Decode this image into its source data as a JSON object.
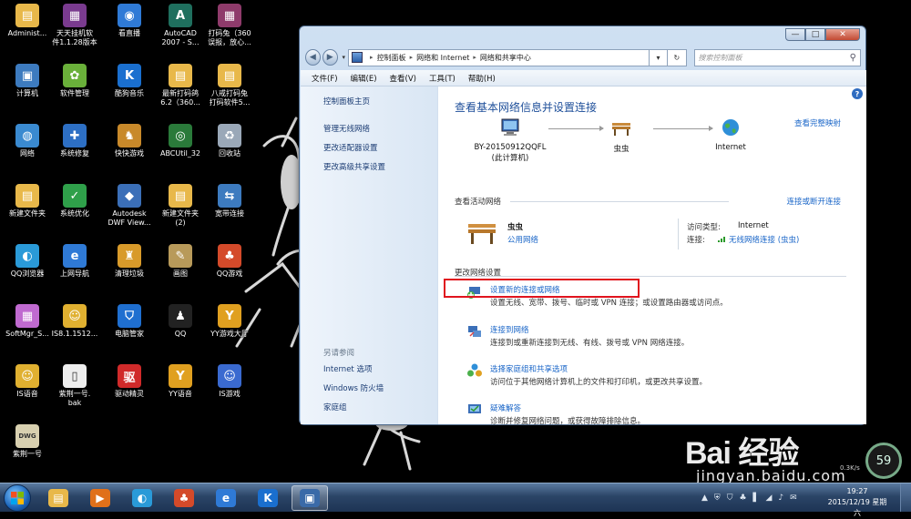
{
  "desktop": {
    "icons": [
      {
        "label": "Administ...",
        "color": "#e8b84a",
        "glyph": "▤",
        "icon": "folder-user-icon"
      },
      {
        "label": "天天挂机软\n件1.1.28版本",
        "color": "#7a3b8f",
        "glyph": "▦",
        "icon": "winrar-icon"
      },
      {
        "label": "看直播",
        "color": "#2f7ad6",
        "glyph": "◉",
        "icon": "live-icon"
      },
      {
        "label": "AutoCAD\n2007 - S...",
        "color": "#1f6f5e",
        "glyph": "A",
        "icon": "autocad-icon"
      },
      {
        "label": "打码兔（360\n误报，放心...",
        "color": "#8f3b6b",
        "glyph": "▦",
        "icon": "winrar-icon"
      },
      {
        "label": "计算机",
        "color": "#3d7bbf",
        "glyph": "▣",
        "icon": "computer-icon"
      },
      {
        "label": "软件管理",
        "color": "#6ab03a",
        "glyph": "✿",
        "icon": "software-manager-icon"
      },
      {
        "label": "酷狗音乐",
        "color": "#1a6fcf",
        "glyph": "K",
        "icon": "kugou-icon"
      },
      {
        "label": "最新打码鸽\n6.2（360...",
        "color": "#e8b84a",
        "glyph": "▤",
        "icon": "folder-icon"
      },
      {
        "label": "八戒打码兔\n打码软件5...",
        "color": "#e8b84a",
        "glyph": "▤",
        "icon": "folder-icon"
      },
      {
        "label": "网络",
        "color": "#3a8ad0",
        "glyph": "◍",
        "icon": "network-icon"
      },
      {
        "label": "系统修复",
        "color": "#2d6fc4",
        "glyph": "✚",
        "icon": "system-repair-icon"
      },
      {
        "label": "快快游戏",
        "color": "#c8892a",
        "glyph": "♞",
        "icon": "game-icon"
      },
      {
        "label": "ABCUtil_32",
        "color": "#2a7a3a",
        "glyph": "◎",
        "icon": "abc-icon"
      },
      {
        "label": "回收站",
        "color": "#9aa8b8",
        "glyph": "♻",
        "icon": "recycle-bin-icon"
      },
      {
        "label": "新建文件夹",
        "color": "#e8b84a",
        "glyph": "▤",
        "icon": "folder-icon"
      },
      {
        "label": "系统优化",
        "color": "#2fa04a",
        "glyph": "✓",
        "icon": "optimize-icon"
      },
      {
        "label": "Autodesk\nDWF View...",
        "color": "#3b6fb8",
        "glyph": "◆",
        "icon": "autodesk-icon"
      },
      {
        "label": "新建文件夹\n(2)",
        "color": "#e8b84a",
        "glyph": "▤",
        "icon": "folder-icon"
      },
      {
        "label": "宽带连接",
        "color": "#3d7bbf",
        "glyph": "⇆",
        "icon": "broadband-icon"
      },
      {
        "label": "QQ浏览器",
        "color": "#2a9ad8",
        "glyph": "◐",
        "icon": "qq-browser-icon"
      },
      {
        "label": "上网导航",
        "color": "#2f7ad6",
        "glyph": "e",
        "icon": "ie-icon"
      },
      {
        "label": "清理垃圾",
        "color": "#d89a2a",
        "glyph": "♜",
        "icon": "cleanup-icon"
      },
      {
        "label": "画图",
        "color": "#b89a5a",
        "glyph": "✎",
        "icon": "paint-icon"
      },
      {
        "label": "QQ游戏",
        "color": "#d44a2a",
        "glyph": "♣",
        "icon": "qq-game-icon"
      },
      {
        "label": "SoftMgr_S...",
        "color": "#c06ad0",
        "glyph": "▦",
        "icon": "softmgr-icon"
      },
      {
        "label": "IS8.1.1512...",
        "color": "#e0b030",
        "glyph": "☺",
        "icon": "is-icon"
      },
      {
        "label": "电脑管家",
        "color": "#1f6fd0",
        "glyph": "⛉",
        "icon": "pc-manager-icon"
      },
      {
        "label": "QQ",
        "color": "#222222",
        "glyph": "♟",
        "icon": "qq-icon"
      },
      {
        "label": "YY游戏大厅",
        "color": "#e0a020",
        "glyph": "Y",
        "icon": "yy-game-icon"
      },
      {
        "label": "IS语音",
        "color": "#e0b030",
        "glyph": "☺",
        "icon": "is-voice-icon"
      },
      {
        "label": "紫荆一号.\nbak",
        "color": "#eeeeee",
        "glyph": "▯",
        "icon": "file-icon"
      },
      {
        "label": "驱动精灵",
        "color": "#d02a2a",
        "glyph": "驱",
        "icon": "driver-icon"
      },
      {
        "label": "YY语音",
        "color": "#e0a020",
        "glyph": "Y",
        "icon": "yy-voice-icon"
      },
      {
        "label": "IS游戏",
        "color": "#3a6ad0",
        "glyph": "☺",
        "icon": "is-game-icon"
      },
      {
        "label": "紫荆一号",
        "color": "#d8d0b0",
        "glyph": "DWG",
        "icon": "dwg-file-icon"
      }
    ]
  },
  "watermark": {
    "logo": "Bai 经验",
    "url": "jingyan.baidu.com"
  },
  "gauge": {
    "percent": "59",
    "speed": "0.3K/s"
  },
  "window": {
    "controls": {
      "min": "—",
      "max": "□",
      "close": "✕"
    },
    "nav": {
      "back": "◀",
      "forward": "▶",
      "dropdown": "▾"
    },
    "address": {
      "crumbs": [
        "控制面板",
        "网络和 Internet",
        "网络和共享中心"
      ],
      "sep": "▸",
      "dropdown": "▾",
      "refresh": "↻"
    },
    "search": {
      "placeholder": "搜索控制面板"
    },
    "menu": [
      "文件(F)",
      "编辑(E)",
      "查看(V)",
      "工具(T)",
      "帮助(H)"
    ],
    "sidebar": {
      "home": "控制面板主页",
      "items": [
        "管理无线网络",
        "更改适配器设置",
        "更改高级共享设置"
      ],
      "see_also": "另请参阅",
      "see_items": [
        "Internet 选项",
        "Windows 防火墙",
        "家庭组"
      ]
    },
    "main": {
      "help": "?",
      "title": "查看基本网络信息并设置连接",
      "view_map": "查看完整映射",
      "nodes": {
        "computer": {
          "name": "BY-20150912QQFL",
          "sub": "(此计算机)"
        },
        "network": {
          "name": "虫虫"
        },
        "internet": {
          "name": "Internet"
        }
      },
      "active_title": "查看活动网络",
      "connect_link": "连接或断开连接",
      "active": {
        "name": "虫虫",
        "type": "公用网络",
        "access_key": "访问类型:",
        "access_val": "Internet",
        "conn_key": "连接:",
        "conn_val": "无线网络连接 (虫虫)"
      },
      "change_title": "更改网络设置",
      "tasks": [
        {
          "link": "设置新的连接或网络",
          "desc": "设置无线、宽带、拨号、临时或 VPN 连接；或设置路由器或访问点。"
        },
        {
          "link": "连接到网络",
          "desc": "连接到或重新连接到无线、有线、拨号或 VPN 网络连接。"
        },
        {
          "link": "选择家庭组和共享选项",
          "desc": "访问位于其他网络计算机上的文件和打印机，或更改共享设置。"
        },
        {
          "link": "疑难解答",
          "desc": "诊断并修复网络问题，或获得故障排除信息。"
        }
      ]
    }
  },
  "taskbar": {
    "clock": {
      "time": "19:27",
      "date": "2015/12/19 星期六"
    },
    "apps": [
      {
        "icon": "explorer-icon",
        "color": "#e8b84a",
        "glyph": "▤"
      },
      {
        "icon": "media-player-icon",
        "color": "#e0701a",
        "glyph": "▶"
      },
      {
        "icon": "qq-browser-icon",
        "color": "#2a9ad8",
        "glyph": "◐"
      },
      {
        "icon": "qq-game-icon",
        "color": "#d44a2a",
        "glyph": "♣"
      },
      {
        "icon": "ie-icon",
        "color": "#2f7ad6",
        "glyph": "e"
      },
      {
        "icon": "kugou-icon",
        "color": "#1a6fcf",
        "glyph": "K"
      },
      {
        "icon": "control-panel-icon",
        "color": "#3a6aa8",
        "glyph": "▣"
      }
    ],
    "tray": [
      "▲",
      "⛨",
      "⛉",
      "♣",
      "▌",
      "◢",
      "♪",
      "✉"
    ]
  }
}
